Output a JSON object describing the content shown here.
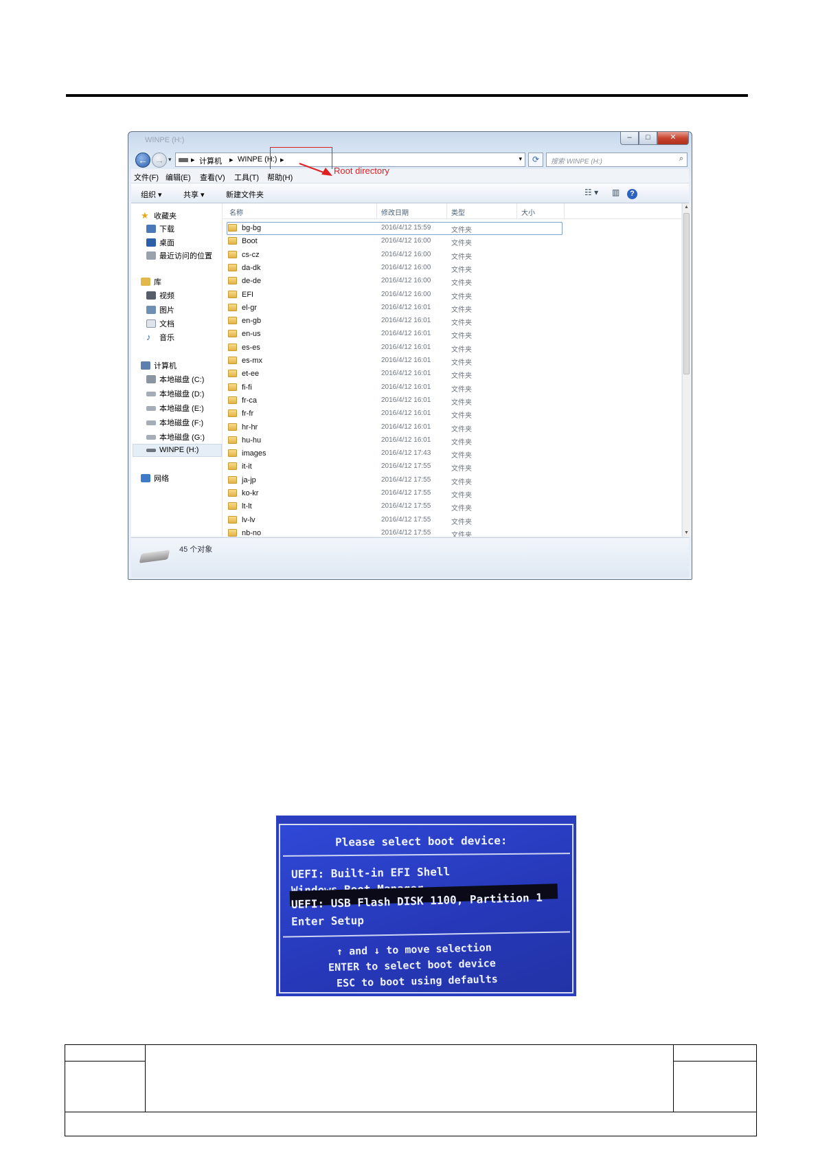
{
  "explorer": {
    "window_title": "WINPE (H:)",
    "address": {
      "computer": "计算机",
      "drive": "WINPE (H:)"
    },
    "search_placeholder": "搜索 WINPE (H:)",
    "annotation": "Root directory",
    "menu": [
      "文件(F)",
      "编辑(E)",
      "查看(V)",
      "工具(T)",
      "帮助(H)"
    ],
    "toolbar": {
      "organize": "组织 ▾",
      "share": "共享 ▾",
      "new_folder": "新建文件夹"
    },
    "nav": {
      "favorites": "收藏夹",
      "downloads": "下载",
      "desktop": "桌面",
      "recent": "最近访问的位置",
      "library": "库",
      "videos": "视频",
      "pictures": "图片",
      "documents": "文档",
      "music": "音乐",
      "computer": "计算机",
      "disk_c": "本地磁盘 (C:)",
      "disk_d": "本地磁盘 (D:)",
      "disk_e": "本地磁盘 (E:)",
      "disk_f": "本地磁盘 (F:)",
      "disk_g": "本地磁盘 (G:)",
      "winpe": "WINPE (H:)",
      "network": "网络"
    },
    "columns": {
      "name": "名称",
      "modified": "修改日期",
      "type": "类型",
      "size": "大小"
    },
    "files": [
      {
        "name": "bg-bg",
        "date": "2016/4/12 15:59",
        "type": "文件夹"
      },
      {
        "name": "Boot",
        "date": "2016/4/12 16:00",
        "type": "文件夹"
      },
      {
        "name": "cs-cz",
        "date": "2016/4/12 16:00",
        "type": "文件夹"
      },
      {
        "name": "da-dk",
        "date": "2016/4/12 16:00",
        "type": "文件夹"
      },
      {
        "name": "de-de",
        "date": "2016/4/12 16:00",
        "type": "文件夹"
      },
      {
        "name": "EFI",
        "date": "2016/4/12 16:00",
        "type": "文件夹"
      },
      {
        "name": "el-gr",
        "date": "2016/4/12 16:01",
        "type": "文件夹"
      },
      {
        "name": "en-gb",
        "date": "2016/4/12 16:01",
        "type": "文件夹"
      },
      {
        "name": "en-us",
        "date": "2016/4/12 16:01",
        "type": "文件夹"
      },
      {
        "name": "es-es",
        "date": "2016/4/12 16:01",
        "type": "文件夹"
      },
      {
        "name": "es-mx",
        "date": "2016/4/12 16:01",
        "type": "文件夹"
      },
      {
        "name": "et-ee",
        "date": "2016/4/12 16:01",
        "type": "文件夹"
      },
      {
        "name": "fi-fi",
        "date": "2016/4/12 16:01",
        "type": "文件夹"
      },
      {
        "name": "fr-ca",
        "date": "2016/4/12 16:01",
        "type": "文件夹"
      },
      {
        "name": "fr-fr",
        "date": "2016/4/12 16:01",
        "type": "文件夹"
      },
      {
        "name": "hr-hr",
        "date": "2016/4/12 16:01",
        "type": "文件夹"
      },
      {
        "name": "hu-hu",
        "date": "2016/4/12 16:01",
        "type": "文件夹"
      },
      {
        "name": "images",
        "date": "2016/4/12 17:43",
        "type": "文件夹"
      },
      {
        "name": "it-it",
        "date": "2016/4/12 17:55",
        "type": "文件夹"
      },
      {
        "name": "ja-jp",
        "date": "2016/4/12 17:55",
        "type": "文件夹"
      },
      {
        "name": "ko-kr",
        "date": "2016/4/12 17:55",
        "type": "文件夹"
      },
      {
        "name": "lt-lt",
        "date": "2016/4/12 17:55",
        "type": "文件夹"
      },
      {
        "name": "lv-lv",
        "date": "2016/4/12 17:55",
        "type": "文件夹"
      },
      {
        "name": "nb-no",
        "date": "2016/4/12 17:55",
        "type": "文件夹"
      }
    ],
    "status": "45 个对象"
  },
  "bios": {
    "title": "Please select boot device:",
    "options": [
      "UEFI: Built-in EFI Shell",
      "Windows Boot Manager",
      "UEFI: USB Flash DISK 1100, Partition 1",
      "Enter Setup"
    ],
    "help": [
      "↑ and ↓ to move selection",
      "ENTER to select boot device",
      "ESC to boot using defaults"
    ]
  },
  "colors": {
    "annotation_red": "#e02020",
    "bios_blue": "#2b3ec0"
  }
}
